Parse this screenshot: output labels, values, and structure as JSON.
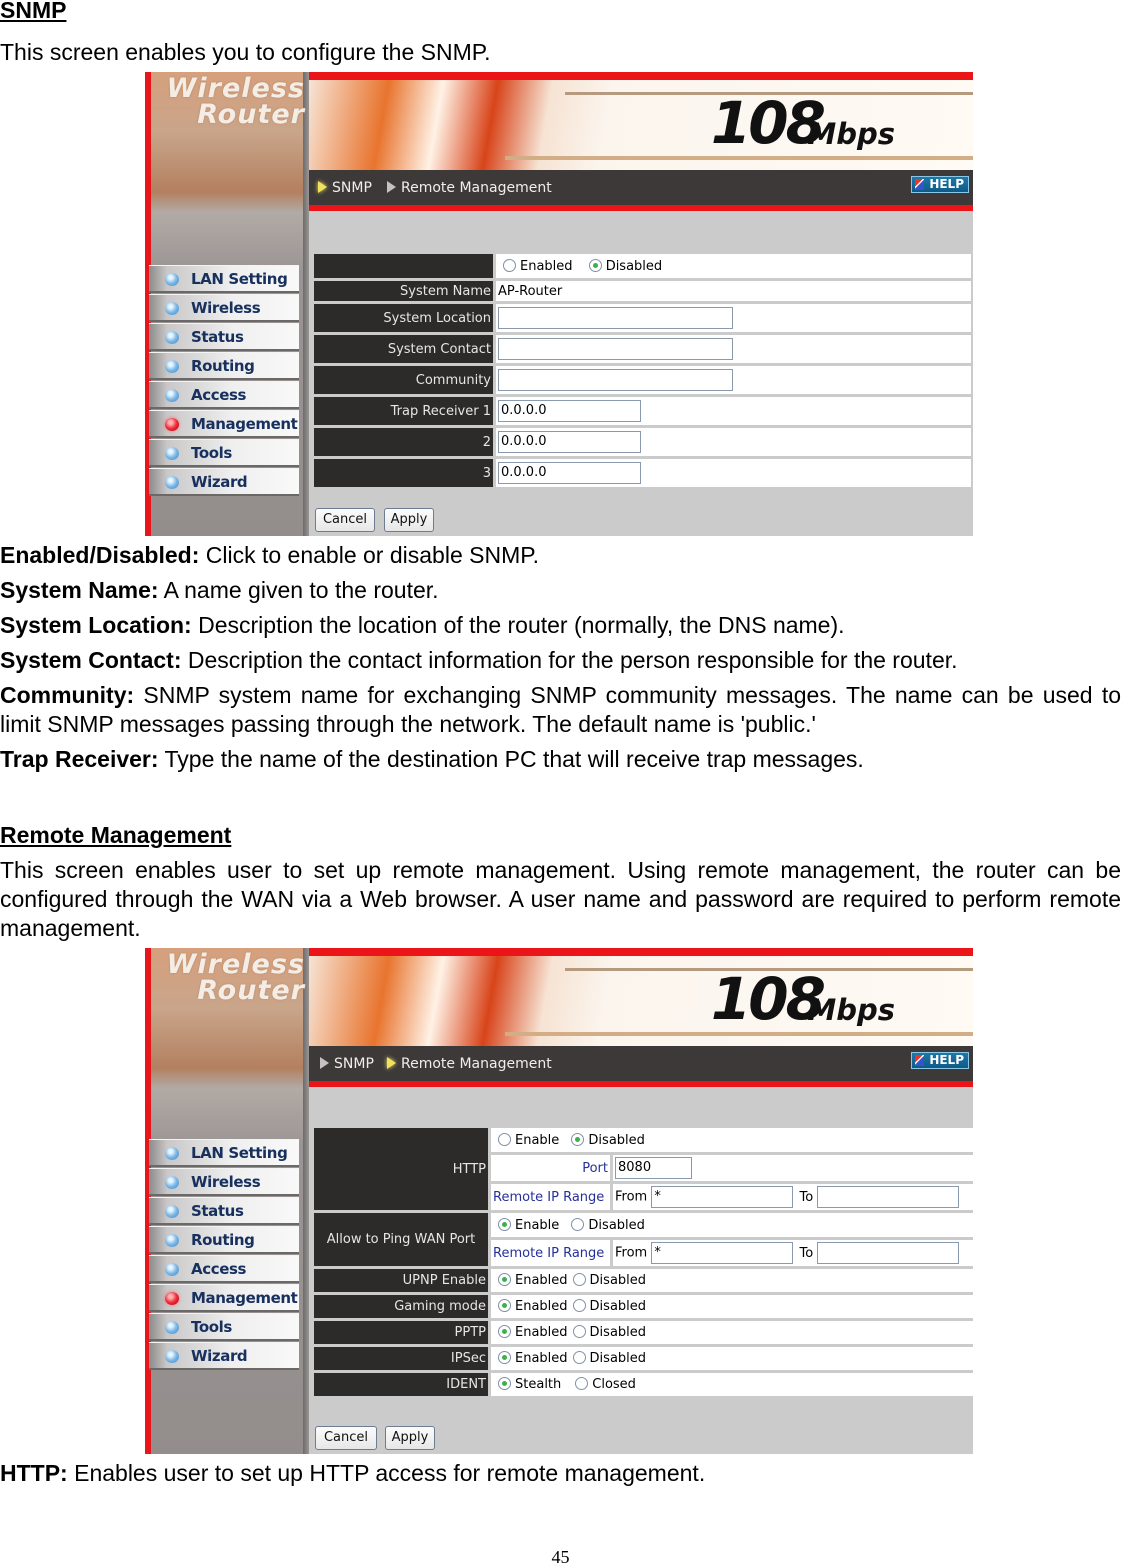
{
  "snmp_section": {
    "heading": "SNMP",
    "intro": "This screen enables you to configure the SNMP.",
    "descriptions": [
      {
        "term": "Enabled/Disabled:",
        "text": " Click to enable or disable SNMP."
      },
      {
        "term": "System Name:",
        "text": " A name given to the router."
      },
      {
        "term": "System Location:",
        "text": " Description the location of the router (normally, the DNS name)."
      },
      {
        "term": "System Contact:",
        "text": " Description the contact information for the person responsible for the router."
      },
      {
        "term": "Community:",
        "text": " SNMP system name for exchanging SNMP community messages. The name can be used to limit SNMP messages passing through the network. The default name is 'public.'"
      },
      {
        "term": "Trap Receiver:",
        "text": " Type the name of the destination PC that will receive trap messages."
      }
    ]
  },
  "remote_section": {
    "heading": "Remote Management",
    "intro": "This screen enables user to set up remote management. Using remote management, the router can be configured through the WAN via a Web browser. A user name and password are required to perform remote management.",
    "descriptions": [
      {
        "term": "HTTP:",
        "text": " Enables user to set up HTTP access for remote management."
      }
    ]
  },
  "router_ui": {
    "logo_line1": "Wireless",
    "logo_line2": "Router",
    "speed": "108",
    "speed_unit": "Mbps",
    "help_label": "HELP",
    "breadcrumb": [
      "SNMP",
      "Remote Management"
    ],
    "menu": [
      "LAN Setting",
      "Wireless",
      "Status",
      "Routing",
      "Access",
      "Management",
      "Tools",
      "Wizard"
    ],
    "active_menu": "Management",
    "cancel_label": "Cancel",
    "apply_label": "Apply",
    "colors": {
      "accent_red": "#ea1419",
      "label_bg": "#2d2a2a",
      "content_bg": "#cbcbcb",
      "link_blue": "#25309a"
    }
  },
  "snmp_form": {
    "active_tab": "SNMP",
    "enable_options": [
      "Enabled",
      "Disabled"
    ],
    "enable_selected": "Disabled",
    "system_name_label": "System Name",
    "system_name_value": "AP-Router",
    "system_location_label": "System Location",
    "system_location_value": "",
    "system_contact_label": "System Contact",
    "system_contact_value": "",
    "community_label": "Community",
    "community_value": "",
    "trap_receivers": [
      {
        "label": "Trap Receiver 1",
        "value": "0.0.0.0"
      },
      {
        "label": "2",
        "value": "0.0.0.0"
      },
      {
        "label": "3",
        "value": "0.0.0.0"
      }
    ]
  },
  "remote_form": {
    "active_tab": "Remote Management",
    "http_label": "HTTP",
    "http_options": [
      "Enable",
      "Disabled"
    ],
    "http_selected": "Disabled",
    "port_label": "Port",
    "port_value": "8080",
    "remote_ip_label": "Remote IP Range",
    "from_label": "From",
    "to_label": "To",
    "http_from": "*",
    "http_to": "",
    "ping_label": "Allow to Ping WAN Port",
    "ping_options": [
      "Enable",
      "Disabled"
    ],
    "ping_selected": "Enable",
    "ping_from": "*",
    "ping_to": "",
    "toggles": [
      {
        "label": "UPNP Enable",
        "options": [
          "Enabled",
          "Disabled"
        ],
        "selected": "Enabled"
      },
      {
        "label": "Gaming mode",
        "options": [
          "Enabled",
          "Disabled"
        ],
        "selected": "Enabled"
      },
      {
        "label": "PPTP",
        "options": [
          "Enabled",
          "Disabled"
        ],
        "selected": "Enabled"
      },
      {
        "label": "IPSec",
        "options": [
          "Enabled",
          "Disabled"
        ],
        "selected": "Enabled"
      },
      {
        "label": "IDENT",
        "options": [
          "Stealth",
          "Closed"
        ],
        "selected": "Stealth"
      }
    ]
  },
  "page_number": "45"
}
